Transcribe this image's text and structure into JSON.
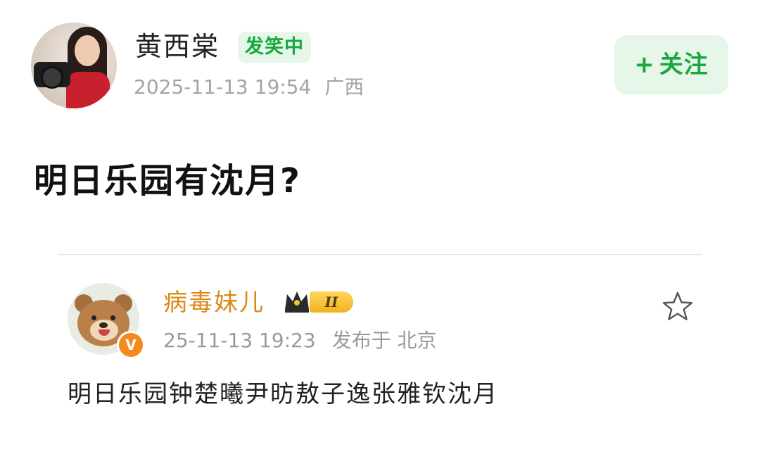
{
  "post": {
    "author": "黄西棠",
    "status_badge": "发笑中",
    "timestamp": "2025-11-13 19:54",
    "location": "广西",
    "follow_plus": "+",
    "follow_label": "关注",
    "title": "明日乐园有沈月?"
  },
  "quoted": {
    "author": "病毒妹儿",
    "level_badge": "II",
    "timestamp": "25-11-13 19:23",
    "published_in": "发布于 北京",
    "text": "明日乐园钟楚曦尹昉敖子逸张雅钦沈月"
  },
  "colors": {
    "accent_green": "#17a93b",
    "badge_green_bg": "#e6f6e8",
    "quoted_name": "#d98a1a",
    "verified_orange": "#f58a1c"
  },
  "icons": {
    "verified": "verified-v-icon",
    "crown": "crown-icon",
    "favorite": "star-outline-icon"
  }
}
